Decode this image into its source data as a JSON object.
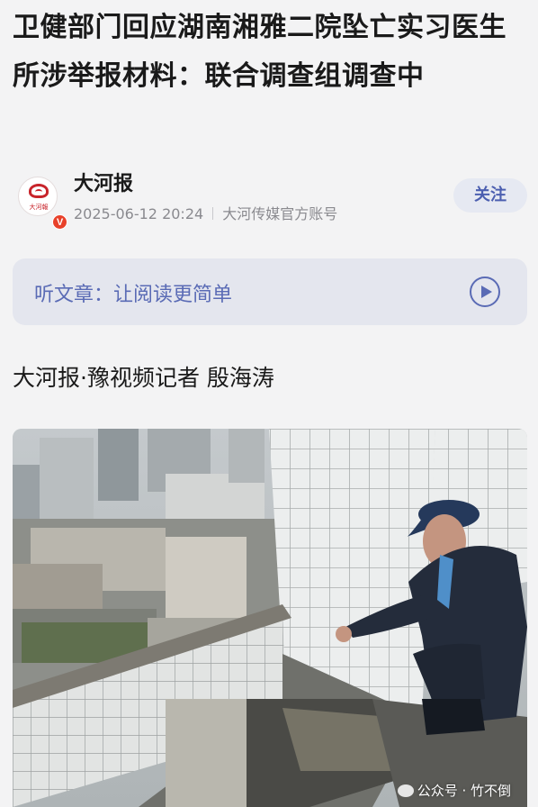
{
  "article": {
    "headline": "卫健部门回应湖南湘雅二院坠亡实习医生所涉举报材料：联合调查组调查中",
    "author": {
      "name": "大河报",
      "avatar_text": "大河報",
      "verified_badge": "V",
      "date": "2025-06-12 20:24",
      "account_type": "大河传媒官方账号"
    },
    "follow_label": "关注",
    "listen": {
      "label": "听文章：让阅读更简单",
      "icon": "play-circle-icon"
    },
    "byline": "大河报·豫视频记者 殷海涛"
  },
  "photo": {
    "watermark": "公众号 · 竹不倒"
  },
  "colors": {
    "accent": "#5a6bb5",
    "follow_bg": "#e6e9f2",
    "listen_bg": "#e4e6ee",
    "badge": "#e8412a"
  }
}
